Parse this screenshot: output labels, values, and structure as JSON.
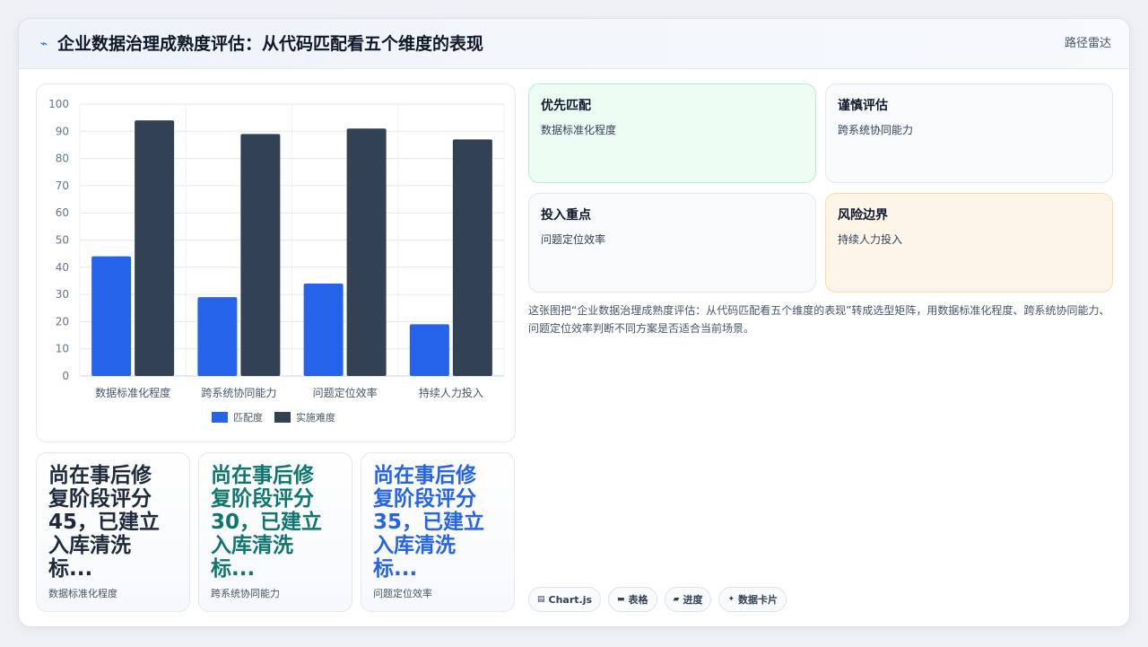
{
  "header": {
    "title": "企业数据治理成熟度评估：从代码匹配看五个维度的表现",
    "link": "路径雷达"
  },
  "colors": {
    "match": "#2563eb",
    "difficulty": "#334155",
    "stat_dark": "#1e293b",
    "stat_green": "#0f766e",
    "stat_blue": "#2563eb"
  },
  "chart_data": {
    "type": "bar",
    "categories": [
      "数据标准化程度",
      "跨系统协同能力",
      "问题定位效率",
      "持续人力投入"
    ],
    "series": [
      {
        "name": "匹配度",
        "values": [
          44,
          29,
          34,
          19
        ]
      },
      {
        "name": "实施难度",
        "values": [
          94,
          89,
          91,
          87
        ]
      }
    ],
    "ylim": [
      0,
      100
    ],
    "yticks": [
      0,
      10,
      20,
      30,
      40,
      50,
      60,
      70,
      80,
      90,
      100
    ],
    "grid": true,
    "legend": "bottom"
  },
  "stats": [
    {
      "value": "尚在事后修\n复阶段评分\n45，已建立\n入库清洗\n标...",
      "label": "数据标准化程度"
    },
    {
      "value": "尚在事后修\n复阶段评分\n30，已建立\n入库清洗\n标...",
      "label": "跨系统协同能力"
    },
    {
      "value": "尚在事后修\n复阶段评分\n35，已建立\n入库清洗\n标...",
      "label": "问题定位效率"
    }
  ],
  "matrix": [
    {
      "title": "优先匹配",
      "subtitle": "数据标准化程度"
    },
    {
      "title": "谨慎评估",
      "subtitle": "跨系统协同能力"
    },
    {
      "title": "投入重点",
      "subtitle": "问题定位效率"
    },
    {
      "title": "风险边界",
      "subtitle": "持续人力投入"
    }
  ],
  "description": "这张图把“企业数据治理成熟度评估：从代码匹配看五个维度的表现”转成选型矩阵，用数据标准化程度、跨系统协同能力、问题定位效率判断不同方案是否适合当前场景。",
  "tags": [
    {
      "icon": "chart-icon",
      "label": "Chart.js"
    },
    {
      "icon": "table-icon",
      "label": "表格"
    },
    {
      "icon": "progress-icon",
      "label": "进度"
    },
    {
      "icon": "sparkle-icon",
      "label": "数据卡片"
    }
  ]
}
